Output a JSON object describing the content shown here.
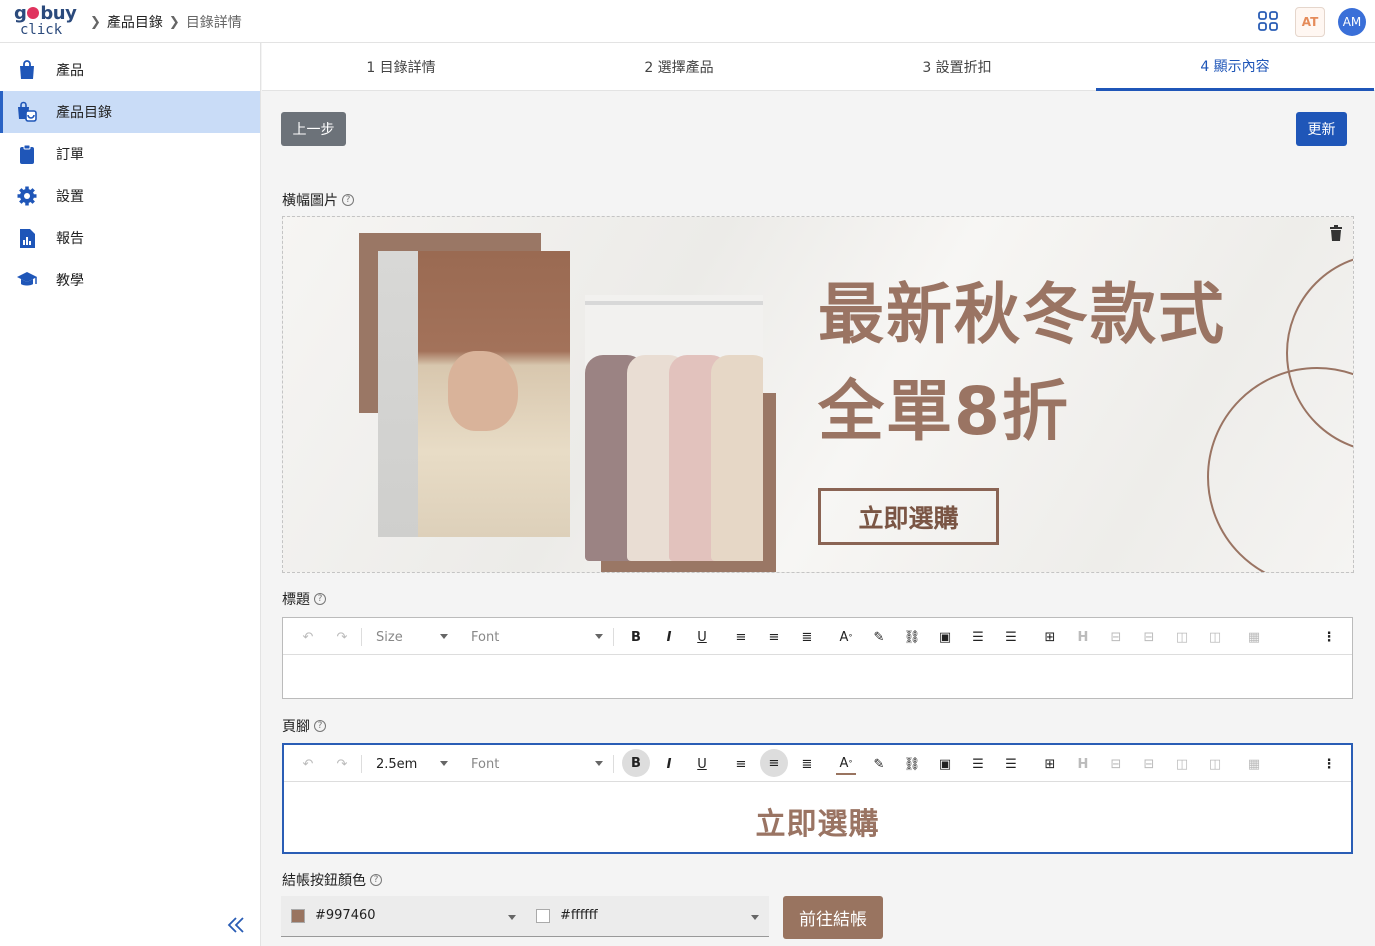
{
  "header": {
    "logo_top": "g",
    "logo_top_rest": "buy",
    "logo_bottom": "click",
    "breadcrumb": [
      "產品目錄",
      "目錄詳情"
    ],
    "at_label": "AT",
    "avatar_initials": "AM"
  },
  "sidebar": {
    "items": [
      {
        "label": "產品",
        "icon": "bag-icon"
      },
      {
        "label": "產品目錄",
        "icon": "catalog-icon"
      },
      {
        "label": "訂單",
        "icon": "clipboard-icon"
      },
      {
        "label": "設置",
        "icon": "gear-icon"
      },
      {
        "label": "報告",
        "icon": "report-icon"
      },
      {
        "label": "教學",
        "icon": "graduation-cap-icon"
      }
    ],
    "active_index": 1
  },
  "steps": [
    {
      "label": "1  目錄詳情"
    },
    {
      "label": "2  選擇產品"
    },
    {
      "label": "3  設置折扣"
    },
    {
      "label": "4  顯示內容"
    }
  ],
  "active_step": 3,
  "buttons": {
    "prev": "上一步",
    "update": "更新",
    "checkout": "前往結帳"
  },
  "banner": {
    "label": "橫幅圖片",
    "title_line1": "最新秋冬款式",
    "title_line2": "全單8折",
    "cta": "立即選購"
  },
  "title_editor": {
    "label": "標題",
    "size_placeholder": "Size",
    "font_placeholder": "Font",
    "content": ""
  },
  "footer_editor": {
    "label": "頁腳",
    "size_value": "2.5em",
    "font_placeholder": "Font",
    "content": "立即選購"
  },
  "checkout_color": {
    "label": "結帳按鈕顏色",
    "bg_color": "#997460",
    "text_color": "#ffffff"
  },
  "toolbar_labels": {
    "bold": "B",
    "italic": "I",
    "underline": "U",
    "font_color": "A",
    "heading": "H"
  },
  "colors": {
    "accent": "#1f56b8",
    "brand_brown": "#997460",
    "sidebar_active": "#c9dcf7"
  }
}
